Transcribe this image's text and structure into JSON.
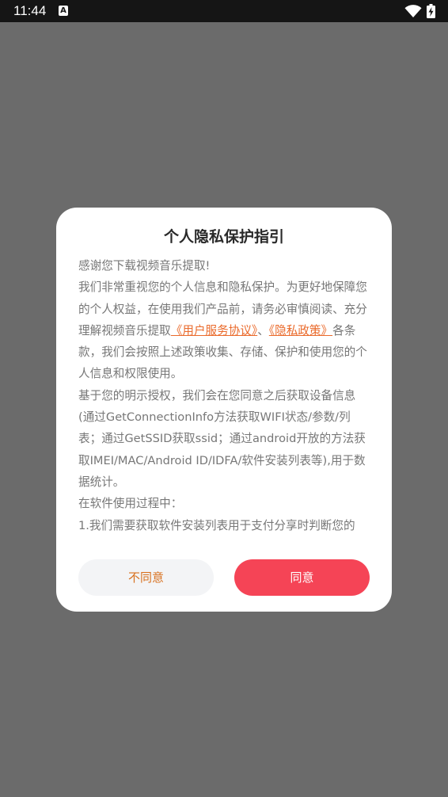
{
  "status_bar": {
    "time": "11:44",
    "notification_icon": "a-icon",
    "wifi_icon": "wifi-icon",
    "battery_icon": "battery-charging-icon"
  },
  "dialog": {
    "title": "个人隐私保护指引",
    "paragraphs": {
      "p1": "感谢您下载视频音乐提取!",
      "p2_start": "我们非常重视您的个人信息和隐私保护。为更好地保障您的个人权益，在使用我们产品前，请务必审慎阅读、充分理解视频音乐提取",
      "link_user_agreement": "《用户服务协议》",
      "p2_sep": "、",
      "link_privacy_policy": "《隐私政策》",
      "p2_end": "各条款，我们会按照上述政策收集、存储、保护和使用您的个人信息和权限使用。",
      "p3": "基于您的明示授权，我们会在您同意之后获取设备信息(通过GetConnectionInfo方法获取WIFI状态/参数/列表；通过GetSSID获取ssid；通过android开放的方法获取IMEI/MAC/Android ID/IDFA/软件安装列表等),用于数据统计。",
      "p4": "在软件使用过程中：",
      "p5": "1.我们需要获取软件安装列表用于支付分享时判断您的"
    },
    "buttons": {
      "disagree": "不同意",
      "agree": "同意"
    }
  },
  "colors": {
    "overlay": "#6b6b6b",
    "link": "#ea6a2b",
    "agree_button": "#f54456",
    "disagree_text": "#d8711f"
  }
}
